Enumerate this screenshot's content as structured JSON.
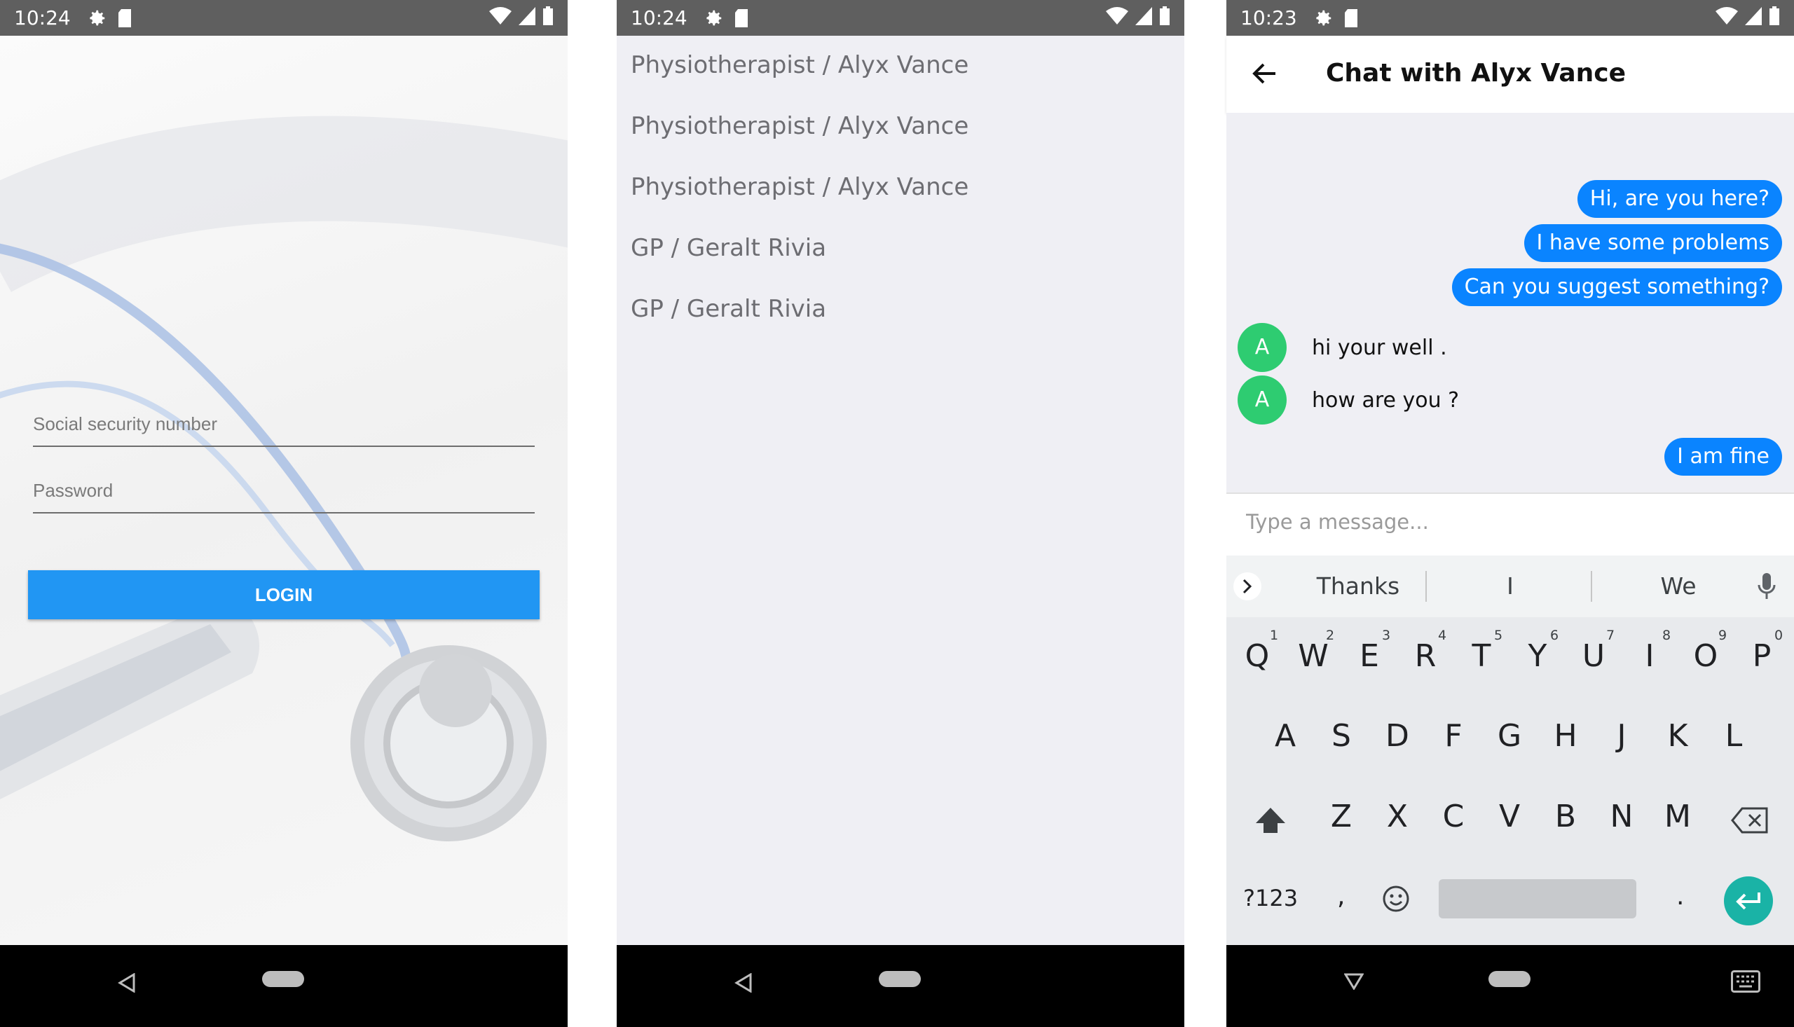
{
  "colors": {
    "status_bar": "#5f5f5f",
    "primary": "#2196f3",
    "bubble": "#0a84ff",
    "avatar": "#2ecc71",
    "enter": "#1ab3a6"
  },
  "login_screen": {
    "status": {
      "time": "10:24"
    },
    "ssn_label": "Social security number",
    "password_label": "Password",
    "login_button": "LOGIN"
  },
  "list_screen": {
    "status": {
      "time": "10:24"
    },
    "items": [
      "Physiotherapist / Alyx Vance",
      "Physiotherapist / Alyx Vance",
      "Physiotherapist / Alyx Vance",
      "GP / Geralt Rivia",
      "GP / Geralt Rivia"
    ]
  },
  "chat_screen": {
    "status": {
      "time": "10:23"
    },
    "title": "Chat with Alyx Vance",
    "sent_1": "Hi, are you here?",
    "sent_2": "I have some problems",
    "sent_3": "Can you suggest something?",
    "recv_1": {
      "avatar": "A",
      "text": "hi your well ."
    },
    "recv_2": {
      "avatar": "A",
      "text": "how are you ?"
    },
    "sent_4": "I am fine",
    "composer_placeholder": "Type a message...",
    "suggestions": [
      "Thanks",
      "I",
      "We"
    ],
    "keys_row1": [
      "Q",
      "W",
      "E",
      "R",
      "T",
      "Y",
      "U",
      "I",
      "O",
      "P"
    ],
    "hints_row1": [
      "1",
      "2",
      "3",
      "4",
      "5",
      "6",
      "7",
      "8",
      "9",
      "0"
    ],
    "keys_row2": [
      "A",
      "S",
      "D",
      "F",
      "G",
      "H",
      "J",
      "K",
      "L"
    ],
    "keys_row3": [
      "Z",
      "X",
      "C",
      "V",
      "B",
      "N",
      "M"
    ],
    "symbols_key": "?123",
    "comma_key": ",",
    "period_key": "."
  },
  "icons": {
    "status": [
      "gear-icon",
      "sd-card-icon",
      "wifi-icon",
      "signal-icon",
      "battery-icon"
    ],
    "nav": [
      "nav-back-icon",
      "nav-home-pill",
      "keyboard-icon"
    ],
    "chat": [
      "back-arrow-icon",
      "chevron-right-icon",
      "mic-icon",
      "shift-icon",
      "backspace-icon",
      "emoji-icon",
      "enter-icon"
    ]
  }
}
